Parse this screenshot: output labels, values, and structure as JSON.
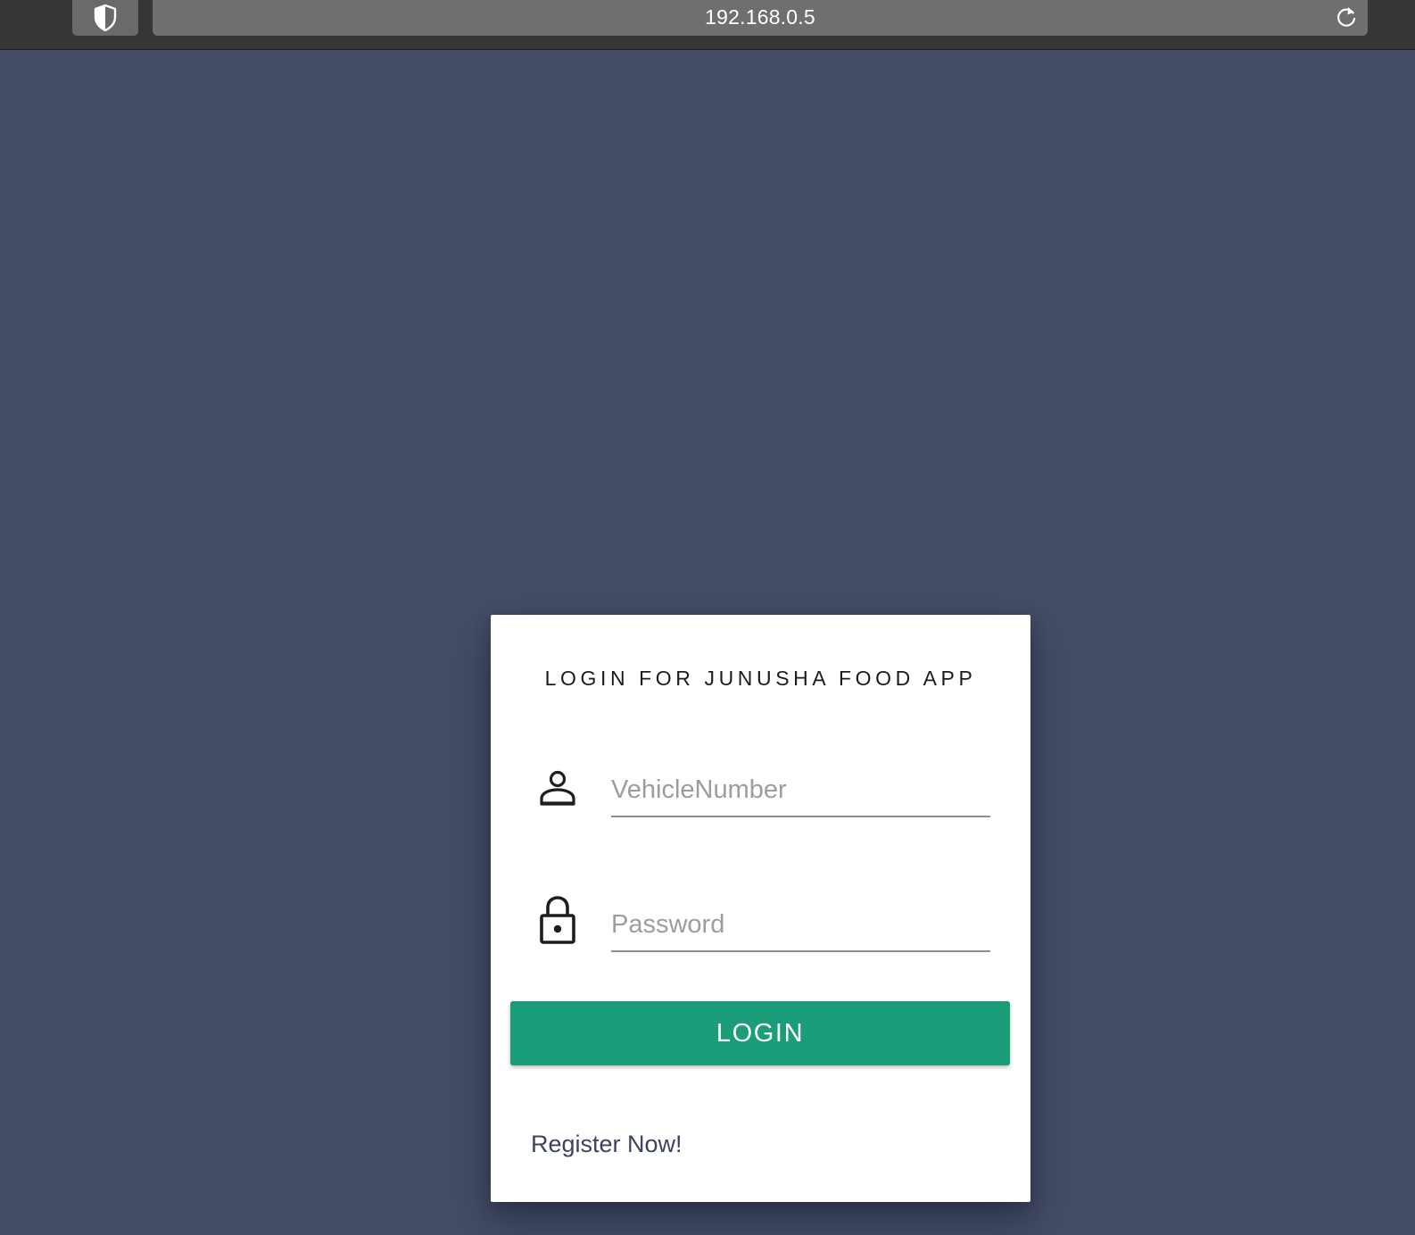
{
  "browser": {
    "url": "192.168.0.5",
    "shield_icon": "shield-icon",
    "reload_icon": "reload-icon"
  },
  "colors": {
    "page_background": "#454d67",
    "card_background": "#ffffff",
    "login_button": "#1a9d78",
    "link": "#3b4360"
  },
  "login_card": {
    "title": "LOGIN FOR JUNUSHA FOOD APP",
    "vehicle_field": {
      "icon": "user-icon",
      "placeholder": "VehicleNumber",
      "value": ""
    },
    "password_field": {
      "icon": "lock-icon",
      "placeholder": "Password",
      "value": ""
    },
    "login_label": "LOGIN",
    "register_label": "Register Now!"
  }
}
